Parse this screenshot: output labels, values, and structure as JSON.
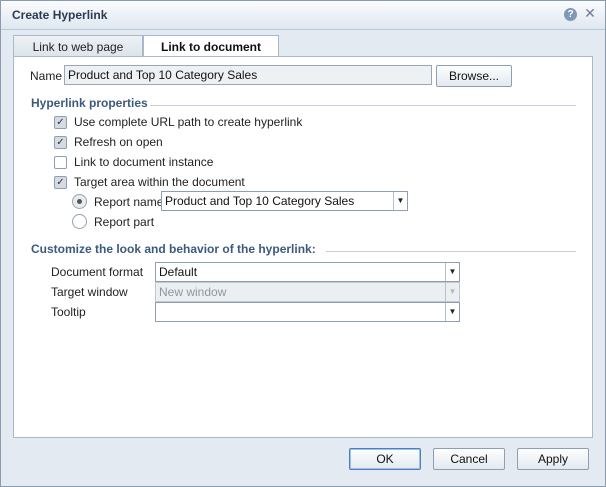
{
  "window": {
    "title": "Create Hyperlink",
    "help_icon": "question-mark-icon",
    "close_icon": "close-icon"
  },
  "tabs": [
    {
      "label": "Link to web page",
      "active": false
    },
    {
      "label": "Link to document",
      "active": true
    }
  ],
  "name_row": {
    "label": "Name",
    "value": "Product and Top 10 Category Sales",
    "browse_label": "Browse..."
  },
  "hyperlink_properties": {
    "heading": "Hyperlink properties",
    "options": [
      {
        "label": "Use complete URL path to create hyperlink",
        "checked": true
      },
      {
        "label": "Refresh on open",
        "checked": true
      },
      {
        "label": "Link to document instance",
        "checked": false
      },
      {
        "label": "Target area within the document",
        "checked": true
      }
    ],
    "target": {
      "report_name_label": "Report name",
      "report_name_selected": true,
      "report_name_value": "Product and Top 10 Category Sales",
      "report_part_label": "Report part",
      "report_part_selected": false
    }
  },
  "customize": {
    "heading": "Customize the look and behavior of the hyperlink:",
    "document_format": {
      "label": "Document format",
      "value": "Default"
    },
    "target_window": {
      "label": "Target window",
      "value": "New window",
      "disabled": true
    },
    "tooltip": {
      "label": "Tooltip",
      "value": ""
    }
  },
  "footer": {
    "ok_label": "OK",
    "cancel_label": "Cancel",
    "apply_label": "Apply"
  },
  "colors": {
    "section_heading": "#3c5a7d",
    "titlebar_text": "#2b3b52",
    "background": "#e4eaf1"
  }
}
